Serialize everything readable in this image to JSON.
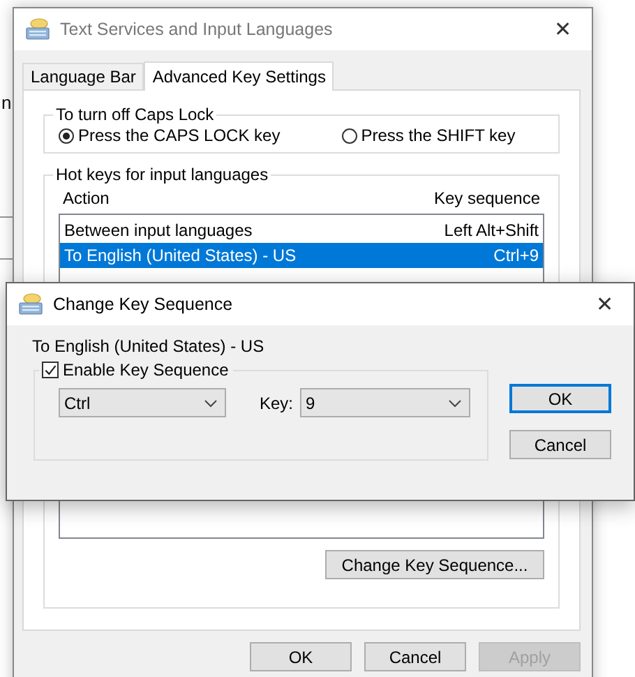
{
  "background": {
    "fragments": [
      "n"
    ]
  },
  "main_window": {
    "title": "Text Services and Input Languages",
    "close": "✕",
    "tabs": [
      {
        "label": "Language Bar",
        "selected": false
      },
      {
        "label": "Advanced Key Settings",
        "selected": true
      }
    ],
    "caps_lock": {
      "legend": "To turn off Caps Lock",
      "options": [
        {
          "label": "Press the CAPS LOCK key",
          "selected": true
        },
        {
          "label": "Press the SHIFT key",
          "selected": false
        }
      ]
    },
    "hot_keys": {
      "legend": "Hot keys for input languages",
      "columns": [
        "Action",
        "Key sequence"
      ],
      "rows": [
        {
          "action": "Between input languages",
          "key_sequence": "Left Alt+Shift",
          "selected": false
        },
        {
          "action": "To English (United States) - US",
          "key_sequence": "Ctrl+9",
          "selected": true
        }
      ],
      "change_button": "Change Key Sequence..."
    },
    "buttons": [
      {
        "label": "OK",
        "disabled": false
      },
      {
        "label": "Cancel",
        "disabled": false
      },
      {
        "label": "Apply",
        "disabled": true
      }
    ]
  },
  "dialog": {
    "title": "Change Key Sequence",
    "close": "✕",
    "target": "To English (United States) - US",
    "enable": {
      "label": "Enable Key Sequence",
      "checked": true
    },
    "modifier": "Ctrl",
    "key_label": "Key:",
    "key": "9",
    "buttons": [
      {
        "label": "OK",
        "default": true
      },
      {
        "label": "Cancel",
        "default": false
      }
    ]
  }
}
